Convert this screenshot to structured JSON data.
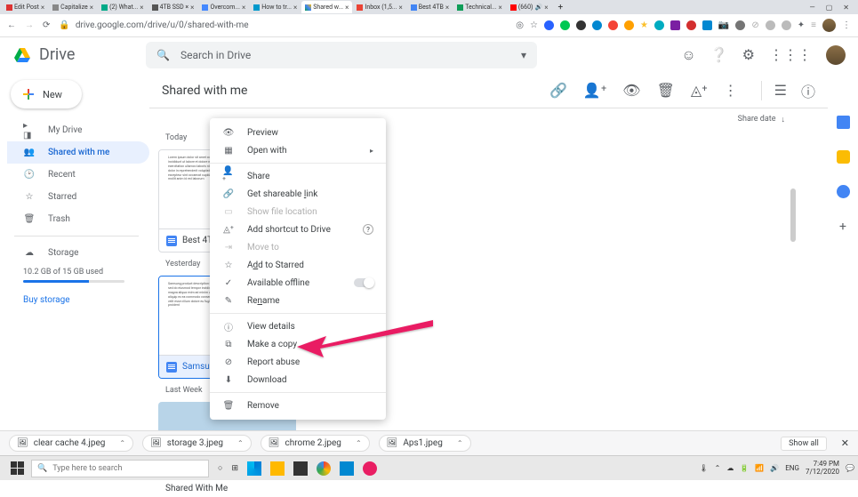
{
  "browser": {
    "tabs": [
      {
        "title": "Edit Post"
      },
      {
        "title": "Capitalize"
      },
      {
        "title": "(2) What..."
      },
      {
        "title": "4TB SSD ×"
      },
      {
        "title": "Overcom..."
      },
      {
        "title": "How to tr..."
      },
      {
        "title": "Shared w..."
      },
      {
        "title": "Inbox (1,5..."
      },
      {
        "title": "Best 4TB"
      },
      {
        "title": "Technical..."
      },
      {
        "title": "(660)"
      }
    ],
    "url": "drive.google.com/drive/u/0/shared-with-me"
  },
  "drive": {
    "logo_text": "Drive",
    "search_placeholder": "Search in Drive",
    "new_label": "New",
    "sidebar": {
      "items": [
        {
          "ico": "▸",
          "label": "My Drive"
        },
        {
          "ico": "⚇",
          "label": "Shared with me"
        },
        {
          "ico": "◔",
          "label": "Recent"
        },
        {
          "ico": "☆",
          "label": "Starred"
        },
        {
          "ico": "🗑",
          "label": "Trash"
        }
      ],
      "storage_label": "Storage",
      "quota_text": "10.2 GB of 15 GB used",
      "buy_label": "Buy storage"
    },
    "page_title": "Shared with me",
    "sort_label": "Share date",
    "sections": [
      {
        "label": "Today",
        "files": [
          {
            "name": "Best 4T..."
          }
        ]
      },
      {
        "label": "Yesterday",
        "files": [
          {
            "name": "Samsun..."
          }
        ]
      },
      {
        "label": "Last Week",
        "files": [
          {
            "name": "Shared With Me"
          }
        ]
      }
    ]
  },
  "context_menu": [
    {
      "icon": "👁",
      "label": "Preview"
    },
    {
      "icon": "▦",
      "label": "Open with",
      "arrow": true
    },
    {
      "sep": true
    },
    {
      "icon": "+",
      "label": "Share"
    },
    {
      "icon": "⊂",
      "label": "Get shareable link",
      "ul": "l"
    },
    {
      "icon": "▭",
      "label": "Show file location",
      "disabled": true
    },
    {
      "icon": "⊕",
      "label": "Add shortcut to Drive",
      "help": true
    },
    {
      "icon": "→",
      "label": "Move to",
      "disabled": true
    },
    {
      "icon": "☆",
      "label": "Add to Starred",
      "ul": "d"
    },
    {
      "icon": "✓",
      "label": "Available offline",
      "toggle": true
    },
    {
      "icon": "✎",
      "label": "Rename",
      "ul": "n"
    },
    {
      "sep": true
    },
    {
      "icon": "ⓘ",
      "label": "View details"
    },
    {
      "icon": "⧉",
      "label": "Make a copy"
    },
    {
      "icon": "⊘",
      "label": "Report abuse"
    },
    {
      "icon": "⬇",
      "label": "Download"
    },
    {
      "sep": true
    },
    {
      "icon": "🗑",
      "label": "Remove"
    }
  ],
  "downloads": [
    {
      "name": "clear cache 4.jpeg"
    },
    {
      "name": "storage 3.jpeg"
    },
    {
      "name": "chrome 2.jpeg"
    },
    {
      "name": "Aps1.jpeg"
    }
  ],
  "downloads_show_all": "Show all",
  "taskbar": {
    "search_placeholder": "Type here to search",
    "lang": "ENG",
    "time": "7:49 PM",
    "date": "7/12/2020"
  }
}
